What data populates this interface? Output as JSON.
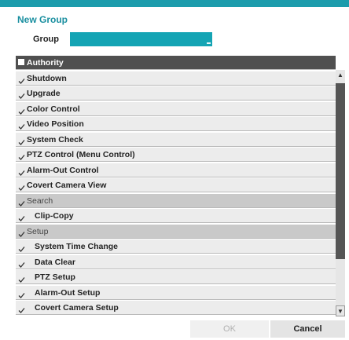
{
  "dialog": {
    "title": "New Group"
  },
  "group": {
    "label": "Group",
    "value": ""
  },
  "authority": {
    "header": "Authority",
    "items": [
      {
        "label": "Shutdown",
        "checked": true,
        "type": "item"
      },
      {
        "label": "Upgrade",
        "checked": true,
        "type": "item"
      },
      {
        "label": "Color Control",
        "checked": true,
        "type": "item"
      },
      {
        "label": "Video Position",
        "checked": true,
        "type": "item"
      },
      {
        "label": "System Check",
        "checked": true,
        "type": "item"
      },
      {
        "label": "PTZ Control (Menu Control)",
        "checked": true,
        "type": "item"
      },
      {
        "label": "Alarm-Out Control",
        "checked": true,
        "type": "item"
      },
      {
        "label": "Covert Camera View",
        "checked": true,
        "type": "item"
      },
      {
        "label": "Search",
        "checked": true,
        "type": "section"
      },
      {
        "label": "Clip-Copy",
        "checked": true,
        "type": "subitem"
      },
      {
        "label": "Setup",
        "checked": true,
        "type": "section"
      },
      {
        "label": "System Time Change",
        "checked": true,
        "type": "subitem"
      },
      {
        "label": "Data Clear",
        "checked": true,
        "type": "subitem"
      },
      {
        "label": "PTZ Setup",
        "checked": true,
        "type": "subitem"
      },
      {
        "label": "Alarm-Out Setup",
        "checked": true,
        "type": "subitem"
      },
      {
        "label": "Covert Camera Setup",
        "checked": true,
        "type": "subitem"
      }
    ]
  },
  "buttons": {
    "ok": "OK",
    "cancel": "Cancel"
  },
  "colors": {
    "accent": "#1c9cac",
    "input": "#14a4b4",
    "header": "#505050",
    "section": "#c9c9c9"
  }
}
